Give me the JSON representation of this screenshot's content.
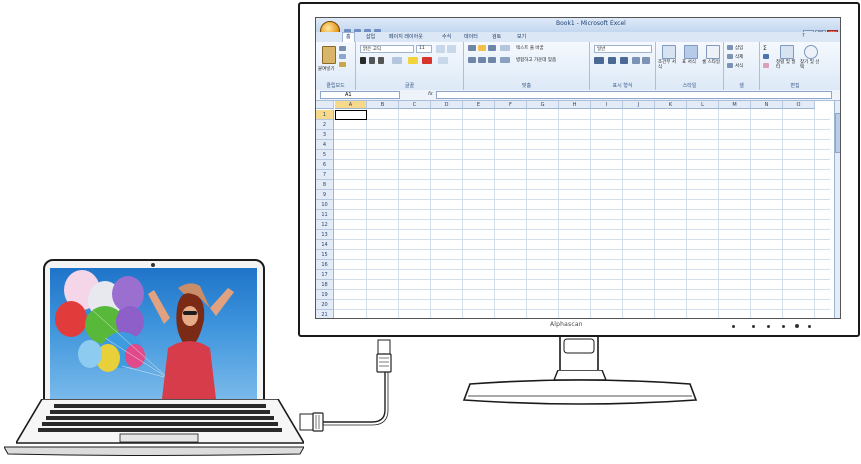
{
  "excel": {
    "title": "Book1 - Microsoft Excel",
    "tabs": [
      "홈",
      "삽입",
      "페이지 레이아웃",
      "수식",
      "데이터",
      "검토",
      "보기"
    ],
    "active_tab": "홈",
    "ribbon": {
      "clipboard": {
        "paste_label": "붙여넣기",
        "group_label": "클립보드"
      },
      "font": {
        "font_name": "맑은 고딕",
        "font_size": "11",
        "group_label": "글꼴"
      },
      "alignment": {
        "wrap_text": "텍스트 줄 바꿈",
        "merge_center": "병합하고 가운데 맞춤",
        "group_label": "맞춤"
      },
      "number": {
        "format": "일반",
        "group_label": "표시 형식"
      },
      "styles": {
        "conditional": "조건부 서식",
        "table": "표 서식",
        "cell_styles": "셀 스타일",
        "group_label": "스타일"
      },
      "cells": {
        "insert": "삽입",
        "delete": "삭제",
        "format": "서식",
        "group_label": "셀"
      },
      "editing": {
        "sort_filter": "정렬 및 필터",
        "find_select": "찾기 및 선택",
        "group_label": "편집"
      }
    },
    "name_box": "A1",
    "fx": "fx",
    "columns": [
      "A",
      "B",
      "C",
      "D",
      "E",
      "F",
      "G",
      "H",
      "I",
      "J",
      "K",
      "L",
      "M",
      "N",
      "O"
    ],
    "rows": [
      "1",
      "2",
      "3",
      "4",
      "5",
      "6",
      "7",
      "8",
      "9",
      "10",
      "11",
      "12",
      "13",
      "14",
      "15",
      "16",
      "17",
      "18",
      "19",
      "20",
      "21"
    ]
  },
  "monitor": {
    "brand": "Alphascan"
  },
  "colors": {
    "ribbon_accent": "#dbe7f5",
    "selection": "#f7d98b",
    "laptop_sky": "#3e95dc"
  }
}
